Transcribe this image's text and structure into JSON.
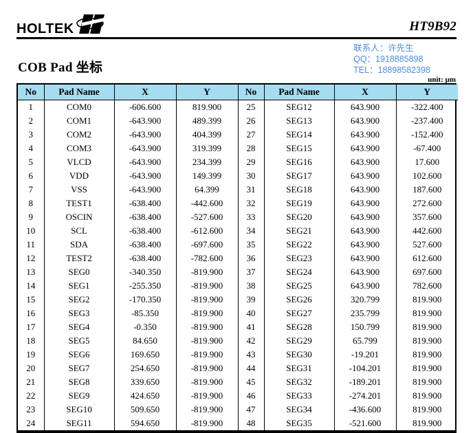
{
  "header": {
    "logo_text": "HOLTEK",
    "logo_mark_icon": "holtek-lightning-icon",
    "part_number": "HT9B92"
  },
  "title_band": {
    "doc_title": "COB Pad 坐标",
    "unit_note": "unit: μm",
    "contact": {
      "accent_color": "#4f8ddb",
      "lines": [
        "联系人：许先生",
        "QQ：1918885898",
        "TEL：18898582398"
      ]
    }
  },
  "table": {
    "header_bg": "#a6dcf0",
    "columns": [
      "No",
      "Pad Name",
      "X",
      "Y",
      "No",
      "Pad Name",
      "X",
      "Y"
    ],
    "rows": [
      {
        "no_l": "1",
        "name_l": "COM0",
        "x_l": "-606.600",
        "y_l": "819.900",
        "no_r": "25",
        "name_r": "SEG12",
        "x_r": "643.900",
        "y_r": "-322.400"
      },
      {
        "no_l": "2",
        "name_l": "COM1",
        "x_l": "-643.900",
        "y_l": "489.399",
        "no_r": "26",
        "name_r": "SEG13",
        "x_r": "643.900",
        "y_r": "-237.400"
      },
      {
        "no_l": "3",
        "name_l": "COM2",
        "x_l": "-643.900",
        "y_l": "404.399",
        "no_r": "27",
        "name_r": "SEG14",
        "x_r": "643.900",
        "y_r": "-152.400"
      },
      {
        "no_l": "4",
        "name_l": "COM3",
        "x_l": "-643.900",
        "y_l": "319.399",
        "no_r": "28",
        "name_r": "SEG15",
        "x_r": "643.900",
        "y_r": "-67.400"
      },
      {
        "no_l": "5",
        "name_l": "VLCD",
        "x_l": "-643.900",
        "y_l": "234.399",
        "no_r": "29",
        "name_r": "SEG16",
        "x_r": "643.900",
        "y_r": "17.600"
      },
      {
        "no_l": "6",
        "name_l": "VDD",
        "x_l": "-643.900",
        "y_l": "149.399",
        "no_r": "30",
        "name_r": "SEG17",
        "x_r": "643.900",
        "y_r": "102.600"
      },
      {
        "no_l": "7",
        "name_l": "VSS",
        "x_l": "-643.900",
        "y_l": "64.399",
        "no_r": "31",
        "name_r": "SEG18",
        "x_r": "643.900",
        "y_r": "187.600"
      },
      {
        "no_l": "8",
        "name_l": "TEST1",
        "x_l": "-638.400",
        "y_l": "-442.600",
        "no_r": "32",
        "name_r": "SEG19",
        "x_r": "643.900",
        "y_r": "272.600"
      },
      {
        "no_l": "9",
        "name_l": "OSCIN",
        "x_l": "-638.400",
        "y_l": "-527.600",
        "no_r": "33",
        "name_r": "SEG20",
        "x_r": "643.900",
        "y_r": "357.600"
      },
      {
        "no_l": "10",
        "name_l": "SCL",
        "x_l": "-638.400",
        "y_l": "-612.600",
        "no_r": "34",
        "name_r": "SEG21",
        "x_r": "643.900",
        "y_r": "442.600"
      },
      {
        "no_l": "11",
        "name_l": "SDA",
        "x_l": "-638.400",
        "y_l": "-697.600",
        "no_r": "35",
        "name_r": "SEG22",
        "x_r": "643.900",
        "y_r": "527.600"
      },
      {
        "no_l": "12",
        "name_l": "TEST2",
        "x_l": "-638.400",
        "y_l": "-782.600",
        "no_r": "36",
        "name_r": "SEG23",
        "x_r": "643.900",
        "y_r": "612.600"
      },
      {
        "no_l": "13",
        "name_l": "SEG0",
        "x_l": "-340.350",
        "y_l": "-819.900",
        "no_r": "37",
        "name_r": "SEG24",
        "x_r": "643.900",
        "y_r": "697.600"
      },
      {
        "no_l": "14",
        "name_l": "SEG1",
        "x_l": "-255.350",
        "y_l": "-819.900",
        "no_r": "38",
        "name_r": "SEG25",
        "x_r": "643.900",
        "y_r": "782.600"
      },
      {
        "no_l": "15",
        "name_l": "SEG2",
        "x_l": "-170.350",
        "y_l": "-819.900",
        "no_r": "39",
        "name_r": "SEG26",
        "x_r": "320.799",
        "y_r": "819.900"
      },
      {
        "no_l": "16",
        "name_l": "SEG3",
        "x_l": "-85.350",
        "y_l": "-819.900",
        "no_r": "40",
        "name_r": "SEG27",
        "x_r": "235.799",
        "y_r": "819.900"
      },
      {
        "no_l": "17",
        "name_l": "SEG4",
        "x_l": "-0.350",
        "y_l": "-819.900",
        "no_r": "41",
        "name_r": "SEG28",
        "x_r": "150.799",
        "y_r": "819.900"
      },
      {
        "no_l": "18",
        "name_l": "SEG5",
        "x_l": "84.650",
        "y_l": "-819.900",
        "no_r": "42",
        "name_r": "SEG29",
        "x_r": "65.799",
        "y_r": "819.900"
      },
      {
        "no_l": "19",
        "name_l": "SEG6",
        "x_l": "169.650",
        "y_l": "-819.900",
        "no_r": "43",
        "name_r": "SEG30",
        "x_r": "-19.201",
        "y_r": "819.900"
      },
      {
        "no_l": "20",
        "name_l": "SEG7",
        "x_l": "254.650",
        "y_l": "-819.900",
        "no_r": "44",
        "name_r": "SEG31",
        "x_r": "-104.201",
        "y_r": "819.900"
      },
      {
        "no_l": "21",
        "name_l": "SEG8",
        "x_l": "339.650",
        "y_l": "-819.900",
        "no_r": "45",
        "name_r": "SEG32",
        "x_r": "-189.201",
        "y_r": "819.900"
      },
      {
        "no_l": "22",
        "name_l": "SEG9",
        "x_l": "424.650",
        "y_l": "-819.900",
        "no_r": "46",
        "name_r": "SEG33",
        "x_r": "-274.201",
        "y_r": "819.900"
      },
      {
        "no_l": "23",
        "name_l": "SEG10",
        "x_l": "509.650",
        "y_l": "-819.900",
        "no_r": "47",
        "name_r": "SEG34",
        "x_r": "-436.600",
        "y_r": "819.900"
      },
      {
        "no_l": "24",
        "name_l": "SEG11",
        "x_l": "594.650",
        "y_l": "-819.900",
        "no_r": "48",
        "name_r": "SEG35",
        "x_r": "-521.600",
        "y_r": "819.900"
      }
    ]
  }
}
